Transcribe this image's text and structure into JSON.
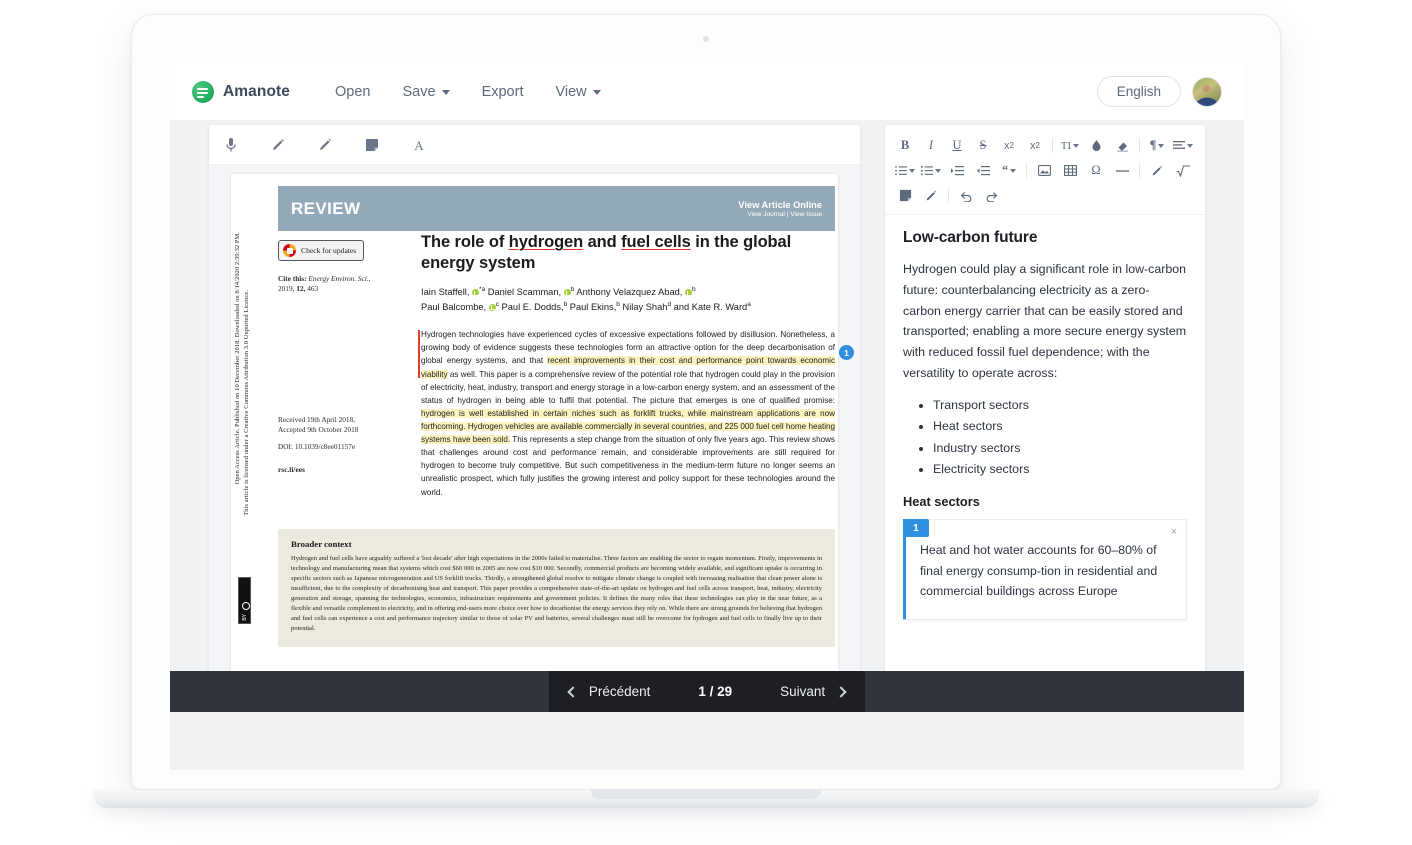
{
  "app": {
    "brand": "Amanote",
    "nav": [
      {
        "label": "Open",
        "has_caret": false
      },
      {
        "label": "Save",
        "has_caret": true
      },
      {
        "label": "Export",
        "has_caret": false
      },
      {
        "label": "View",
        "has_caret": true
      }
    ],
    "language_button": "English"
  },
  "pdf_toolbar": {
    "tools": [
      "microphone-icon",
      "highlighter-icon",
      "pencil-icon",
      "note-icon",
      "text-icon"
    ]
  },
  "document": {
    "banner": {
      "label": "REVIEW",
      "link_primary": "View Article Online",
      "link_secondary": "View Journal | View Issue"
    },
    "license_vertical_1": "Open Access Article. Published on 10 December 2018. Downloaded on 8/14/2020 2:39:32 PM.",
    "license_vertical_2": "This article is licensed under a Creative Commons Attribution 3.0 Unported Licence.",
    "cc_badge": "BY",
    "check_for_updates": "Check for updates",
    "cite_label": "Cite this:",
    "cite_journal": "Energy Environ. Sci.,",
    "cite_year": "2019,",
    "cite_volume": "12,",
    "cite_pages": "463",
    "received": "Received 19th April 2018,",
    "accepted": "Accepted 9th October 2018",
    "doi": "DOI: 10.1039/c8ee01157e",
    "website": "rsc.li/ees",
    "title_parts": [
      {
        "text": "The role of ",
        "underline": false
      },
      {
        "text": "hydrogen",
        "underline": true
      },
      {
        "text": " and ",
        "underline": false
      },
      {
        "text": "fuel cells",
        "underline": true
      },
      {
        "text": " in the global energy system",
        "underline": false
      }
    ],
    "authors_line_1": "Iain Staffell, ⦿ *ᵃ Daniel Scamman, ⦿ ᵇ Anthony Velazquez Abad, ⦿ ᵇ",
    "authors_line_2": "Paul Balcombe, ⦿ ᶜ Paul E. Dodds,ᵇ Paul Ekins,ᵇ Nilay Shahᵈ and Kate R. Wardᵃ",
    "abstract_segments": [
      {
        "text": "Hydrogen technologies have experienced cycles of excessive expectations followed by disillusion. Nonetheless, a growing body of evidence suggests these technologies form an attractive option for the deep decarbonisation of global energy systems, and that ",
        "highlight": false
      },
      {
        "text": "recent improvements in their cost and performance point towards economic viability",
        "highlight": true
      },
      {
        "text": " as well. This paper is a comprehensive review of the potential role that hydrogen could play in the provision of electricity, heat, industry, transport and energy storage in a low-carbon energy system, and an assessment of the status of hydrogen in being able to fulfil that potential. The picture that emerges is one of qualified promise: ",
        "highlight": false
      },
      {
        "text": "hydrogen is well established in certain niches such as forklift trucks, while mainstream applications are now forthcoming. Hydrogen vehicles are available commercially in several countries, and 225 000 fuel cell home heating systems have been sold.",
        "highlight": true
      },
      {
        "text": " This represents a step change from the situation of only five years ago. This review shows that challenges around cost and performance remain, and considerable improvements are still required for hydrogen to become truly competitive. But such competitiveness in the medium-term future no longer seems an unrealistic prospect, which fully justifies the growing interest and policy support for these technologies around the world.",
        "highlight": false
      }
    ],
    "annotation_marker_number": "1",
    "broader_context_title": "Broader context",
    "broader_context_body": "Hydrogen and fuel cells have arguably suffered a 'lost decade' after high expectations in the 2000s failed to materialise. Three factors are enabling the sector to regain momentum. Firstly, improvements in technology and manufacturing mean that systems which cost $60 000 in 2005 are now cost $10 000. Secondly, commercial products are becoming widely available, and significant uptake is occurring in specific sectors such as Japanese microgeneration and US forklift trucks. Thirdly, a strengthened global resolve to mitigate climate change is coupled with increasing realisation that clean power alone is insufficient, due to the complexity of decarbonising heat and transport. This paper provides a comprehensive state-of-the-art update on hydrogen and fuel cells across transport, heat, industry, electricity generation and storage, spanning the technologies, economics, infrastructure requirements and government policies. It defines the many roles that these technologies can play in the near future, as a flexible and versatile complement to electricity, and in offering end-users more choice over how to decarbonise the energy services they rely on. While there are strong grounds for believing that hydrogen and fuel cells can experience a cost and performance trajectory similar to those of solar PV and batteries, several challenges must still be overcome for hydrogen and fuel cells to finally live up to their potential."
  },
  "pager": {
    "previous": "Précédent",
    "next": "Suivant",
    "count": "1 / 29"
  },
  "editor_toolbar": {
    "row1": [
      "B",
      "I",
      "U",
      "S",
      "x₂",
      "x²",
      "TI",
      "droplet",
      "fill",
      "¶",
      "align"
    ],
    "row2": [
      "ordered-list",
      "bullet-list",
      "indent",
      "outdent",
      "quote",
      "image",
      "table",
      "Ω",
      "horizontal-rule",
      "eraser",
      "formula"
    ],
    "row3": [
      "page-break",
      "pen",
      "undo",
      "redo"
    ]
  },
  "notes": {
    "title": "Low-carbon future",
    "paragraph": "Hydrogen could play a significant role in low-carbon future: counterbalancing electricity as a zero-carbon energy carrier that can be easily stored and transported; enabling a more secure energy system with reduced fossil fuel dependence; with the versatility to operate across:",
    "list": [
      "Transport sectors",
      "Heat sectors",
      "Industry sectors",
      "Electricity sectors"
    ],
    "subtitle": "Heat sectors",
    "annotation_card": {
      "number": "1",
      "close": "×",
      "text": "Heat and hot water accounts for 60–80% of final energy consump-tion in residential and commercial buildings across Europe"
    }
  },
  "colors": {
    "brand_green": "#22ab5e",
    "accent_blue": "#2f8fe0",
    "banner_blue_gray": "#93a9b7",
    "highlight_yellow": "#fdf3bf",
    "marker_red": "#e03a2c",
    "broader_context_bg": "#eee9de",
    "bottom_bar": "#32353b"
  }
}
